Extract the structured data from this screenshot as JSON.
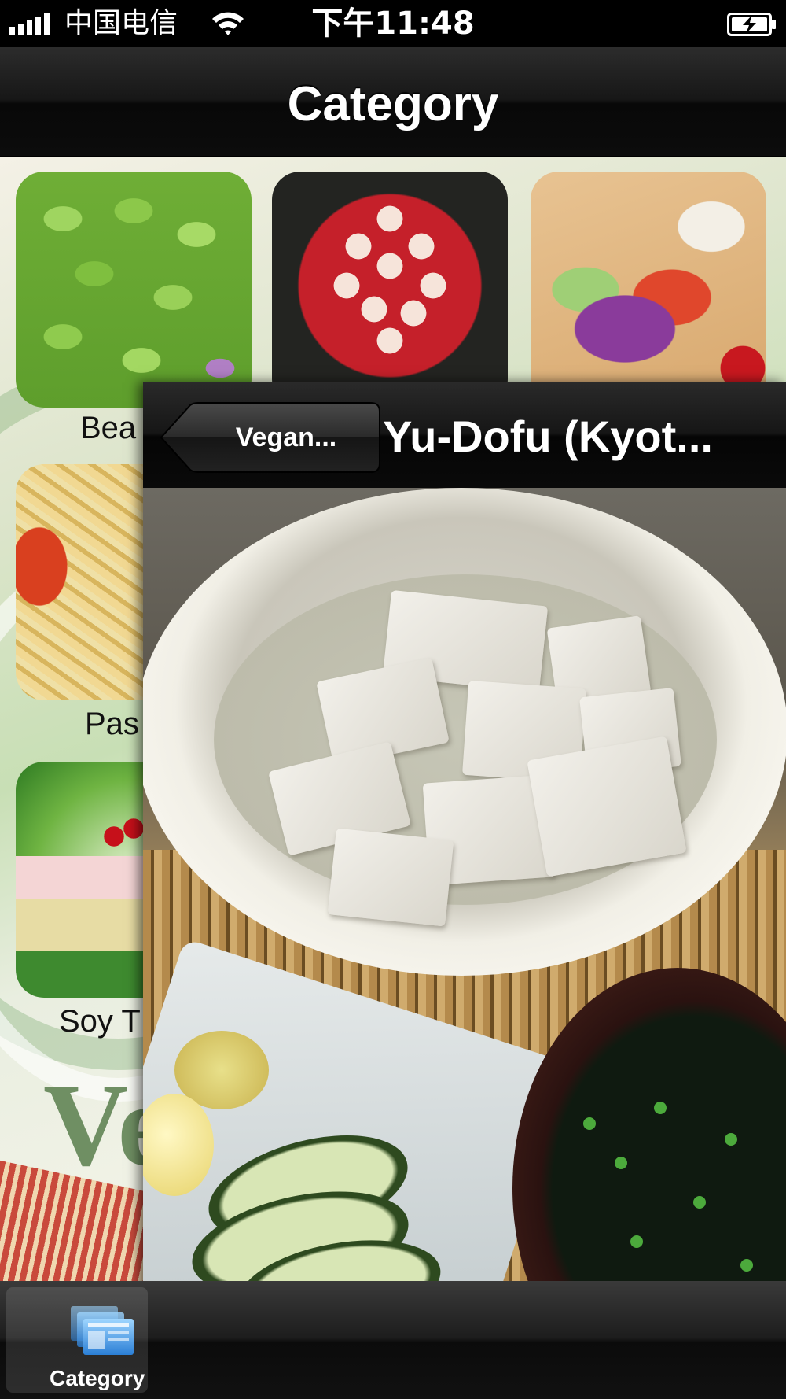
{
  "status_bar": {
    "carrier": "中国电信",
    "time": "下午11:48",
    "icons": [
      "signal-icon",
      "wifi-icon",
      "battery-charging-icon"
    ]
  },
  "navbar": {
    "title": "Category"
  },
  "categories": [
    {
      "label": "Bea",
      "image": "fava-beans"
    },
    {
      "label": "",
      "image": "cookies-on-red-plate"
    },
    {
      "label": "",
      "image": "salad-plate"
    },
    {
      "label": "Pas",
      "image": "pasta"
    },
    {
      "label": "Soy T",
      "image": "soy-dessert"
    }
  ],
  "background": {
    "logo_text": "Ve"
  },
  "detail": {
    "back_label": "Vegan...",
    "title": "Yu-Dofu (Kyot...",
    "photo": "tofu-in-broth"
  },
  "tabbar": {
    "items": [
      {
        "label": "Category",
        "icon": "category-icon",
        "selected": true
      }
    ]
  },
  "colors": {
    "bar_dark": "#0c0c0c",
    "tab_icon_blue": "#3f9be8",
    "logo_green": "#6f8f63"
  }
}
